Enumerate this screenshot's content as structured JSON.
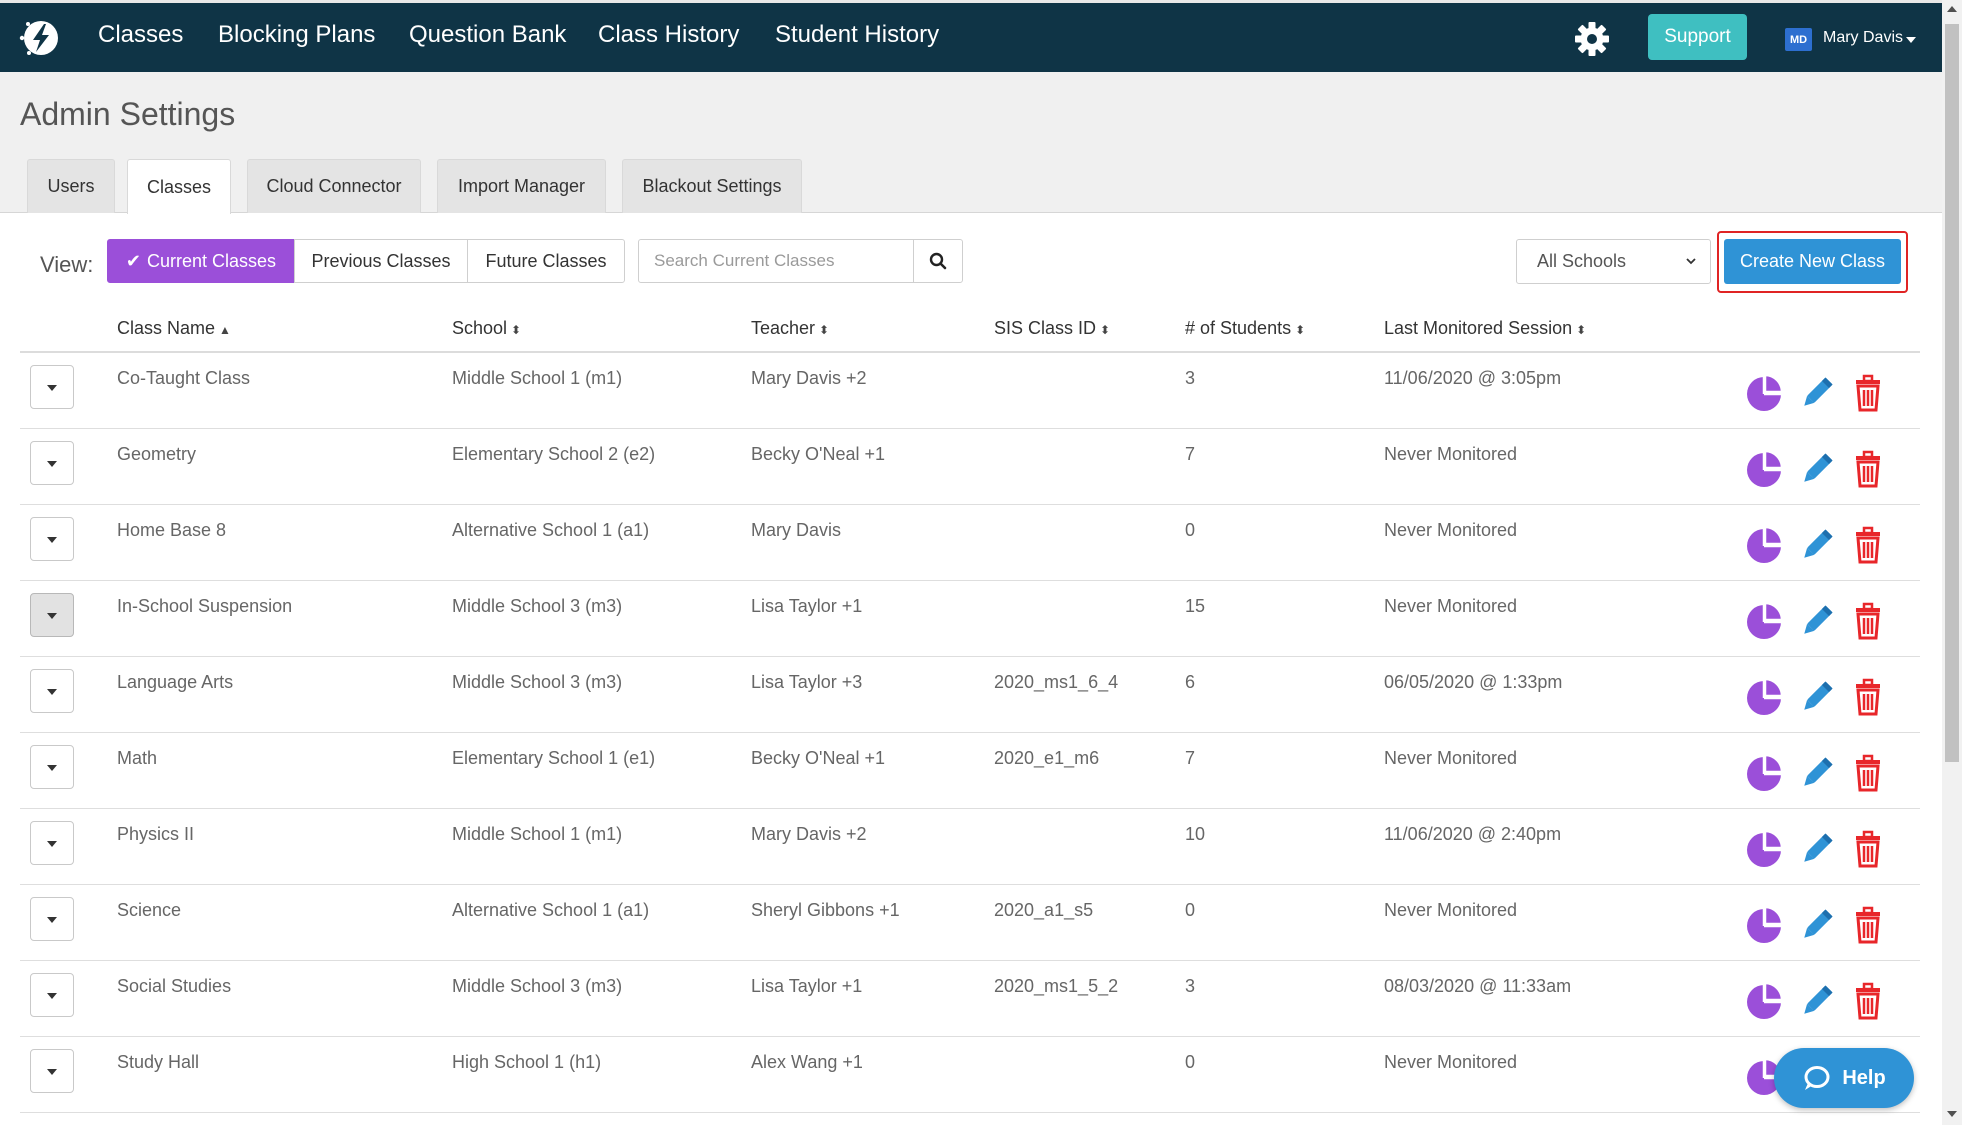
{
  "nav": {
    "logo_icon": "lightning-bolt-logo",
    "links": [
      "Classes",
      "Blocking Plans",
      "Question Bank",
      "Class History",
      "Student History"
    ],
    "settings_icon": "gear-icon",
    "support_label": "Support",
    "user_initials": "MD",
    "user_name": "Mary Davis"
  },
  "page": {
    "title": "Admin Settings",
    "tabs": [
      "Users",
      "Classes",
      "Cloud Connector",
      "Import Manager",
      "Blackout Settings"
    ],
    "active_tab": "Classes"
  },
  "filters": {
    "view_label": "View:",
    "segments": [
      "Current Classes",
      "Previous Classes",
      "Future Classes"
    ],
    "active_segment": "Current Classes",
    "search_placeholder": "Search Current Classes",
    "school_select": "All Schools",
    "create_label": "Create New Class"
  },
  "table": {
    "columns": [
      "Class Name",
      "School",
      "Teacher",
      "SIS Class ID",
      "# of Students",
      "Last Monitored Session"
    ],
    "rows": [
      {
        "name": "Co-Taught Class",
        "school": "Middle School 1 (m1)",
        "teacher": "Mary Davis +2",
        "sis": "",
        "students": "3",
        "last": "11/06/2020 @ 3:05pm"
      },
      {
        "name": "Geometry",
        "school": "Elementary School 2 (e2)",
        "teacher": "Becky O'Neal +1",
        "sis": "",
        "students": "7",
        "last": "Never Monitored"
      },
      {
        "name": "Home Base 8",
        "school": "Alternative School 1 (a1)",
        "teacher": "Mary Davis",
        "sis": "",
        "students": "0",
        "last": "Never Monitored"
      },
      {
        "name": "In-School Suspension",
        "school": "Middle School 3 (m3)",
        "teacher": "Lisa Taylor +1",
        "sis": "",
        "students": "15",
        "last": "Never Monitored"
      },
      {
        "name": "Language Arts",
        "school": "Middle School 3 (m3)",
        "teacher": "Lisa Taylor +3",
        "sis": "2020_ms1_6_4",
        "students": "6",
        "last": "06/05/2020 @ 1:33pm"
      },
      {
        "name": "Math",
        "school": "Elementary School 1 (e1)",
        "teacher": "Becky O'Neal +1",
        "sis": "2020_e1_m6",
        "students": "7",
        "last": "Never Monitored"
      },
      {
        "name": "Physics II",
        "school": "Middle School 1 (m1)",
        "teacher": "Mary Davis +2",
        "sis": "",
        "students": "10",
        "last": "11/06/2020 @ 2:40pm"
      },
      {
        "name": "Science",
        "school": "Alternative School 1 (a1)",
        "teacher": "Sheryl Gibbons +1",
        "sis": "2020_a1_s5",
        "students": "0",
        "last": "Never Monitored"
      },
      {
        "name": "Social Studies",
        "school": "Middle School 3 (m3)",
        "teacher": "Lisa Taylor +1",
        "sis": "2020_ms1_5_2",
        "students": "3",
        "last": "08/03/2020 @ 11:33am"
      },
      {
        "name": "Study Hall",
        "school": "High School 1 (h1)",
        "teacher": "Alex Wang +1",
        "sis": "",
        "students": "0",
        "last": "Never Monitored"
      }
    ]
  },
  "help": {
    "label": "Help",
    "icon": "chat-bubble-icon"
  },
  "colors": {
    "nav_bg": "#0f3446",
    "support": "#3fbfc1",
    "accent_purple": "#9b4fd9",
    "create_blue": "#2f93d6",
    "delete_red": "#e8262a",
    "highlight_red": "#e02424"
  }
}
